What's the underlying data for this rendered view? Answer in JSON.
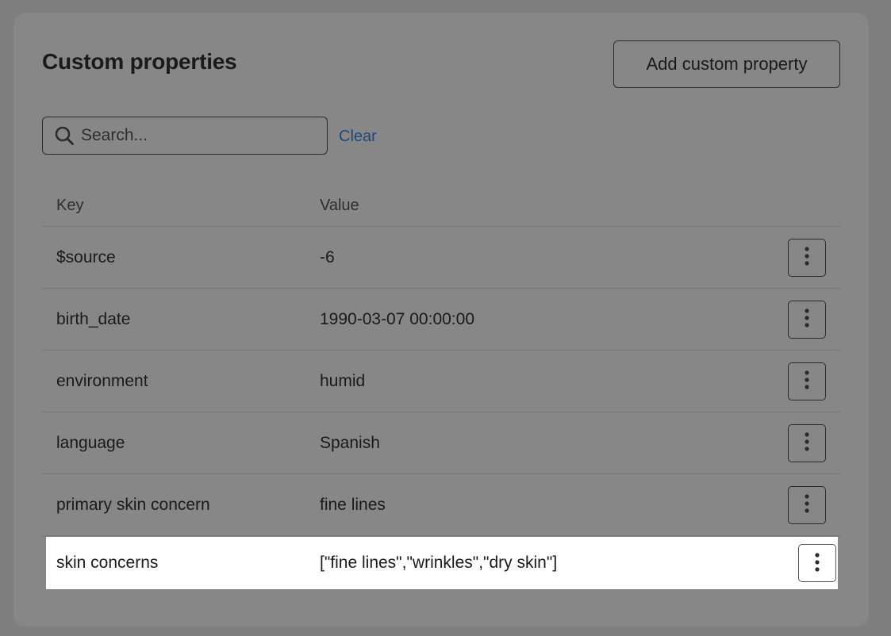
{
  "card": {
    "title": "Custom properties",
    "add_button_label": "Add custom property"
  },
  "search": {
    "placeholder": "Search...",
    "value": "",
    "icon": "search-icon",
    "clear_label": "Clear"
  },
  "table": {
    "columns": [
      "Key",
      "Value"
    ],
    "rows": [
      {
        "key": "$source",
        "value": "-6"
      },
      {
        "key": "birth_date",
        "value": "1990-03-07 00:00:00"
      },
      {
        "key": "environment",
        "value": "humid"
      },
      {
        "key": "language",
        "value": "Spanish"
      },
      {
        "key": "primary skin concern",
        "value": "fine lines"
      },
      {
        "key": "skin concerns",
        "value": "[\"fine lines\",\"wrinkles\",\"dry skin\"]"
      }
    ],
    "row_menu_icon": "more-vertical-icon",
    "highlighted_row_index": 5
  },
  "colors": {
    "backdrop": "#7f7f7f",
    "card": "#878787",
    "link": "#1d4a7a",
    "highlight": "#ffffff"
  }
}
